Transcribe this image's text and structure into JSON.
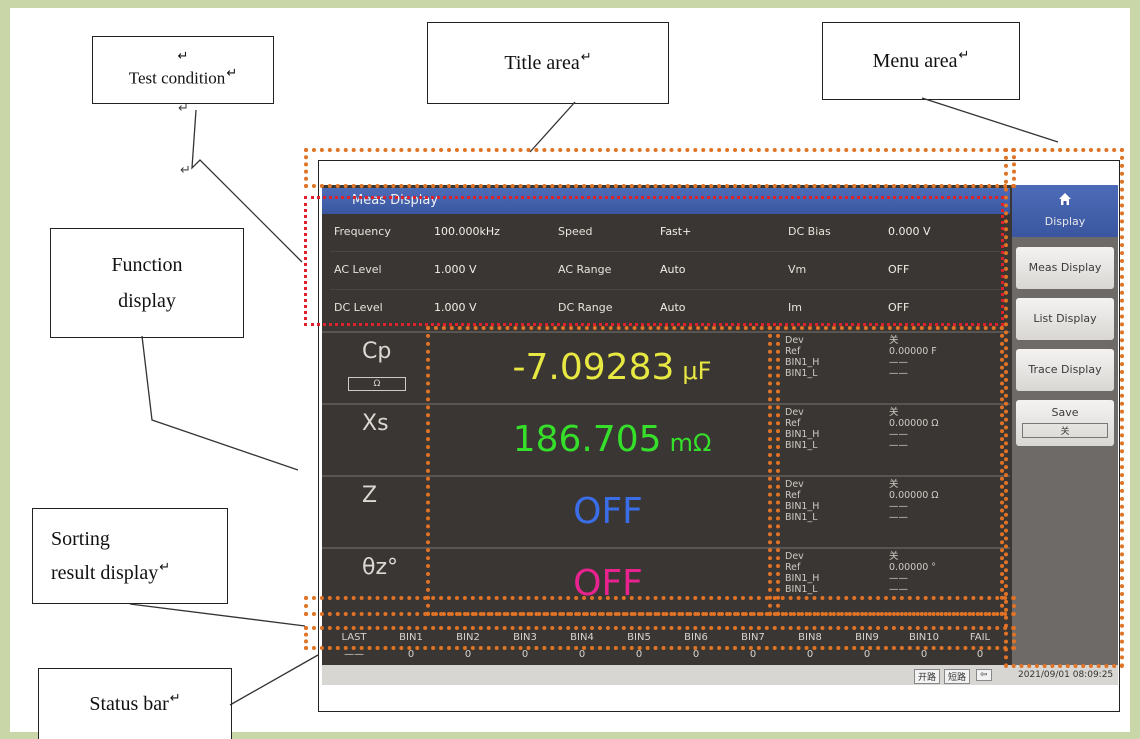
{
  "callouts": {
    "test_condition": "Test condition",
    "title_area": "Title area",
    "menu_area": "Menu area",
    "function_display_line1": "Function",
    "function_display_line2": "display",
    "sorting_line1": "Sorting",
    "sorting_line2": "result display",
    "status_bar": "Status bar",
    "return_mark": "↵"
  },
  "screen": {
    "title": "Meas Display",
    "conditions": [
      {
        "label1": "Frequency",
        "value1": "100.000kHz",
        "label2": "Speed",
        "value2": "Fast+",
        "label3": "DC Bias",
        "value3": "0.000 V"
      },
      {
        "label1": "AC Level",
        "value1": "1.000 V",
        "label2": "AC Range",
        "value2": "Auto",
        "label3": "Vm",
        "value3": "OFF"
      },
      {
        "label1": "DC Level",
        "value1": "1.000 V",
        "label2": "DC Range",
        "value2": "Auto",
        "label3": "Im",
        "value3": "OFF"
      }
    ],
    "measurements": [
      {
        "param": "Cp",
        "value": "-7.09283",
        "unit": "μF",
        "color": "#e8e842",
        "dev": "关",
        "ref": "0.00000 F"
      },
      {
        "param": "Xs",
        "value": "186.705",
        "unit": "mΩ",
        "color": "#36e02a",
        "dev": "关",
        "ref": "0.00000 Ω"
      },
      {
        "param": "Z",
        "value": "OFF",
        "unit": "",
        "color": "#3a6ee8",
        "dev": "关",
        "ref": "0.00000 Ω"
      },
      {
        "param": "θz°",
        "value": "OFF",
        "unit": "",
        "color": "#e8238f",
        "dev": "关",
        "ref": "0.00000 °"
      }
    ],
    "side_labels": {
      "dev": "Dev",
      "ref": "Ref",
      "bin_h": "BIN1_H",
      "bin_l": "BIN1_L",
      "blank": "——"
    },
    "param_selector": "Ω",
    "bins": [
      "LAST",
      "BIN1",
      "BIN2",
      "BIN3",
      "BIN4",
      "BIN5",
      "BIN6",
      "BIN7",
      "BIN8",
      "BIN9",
      "BIN10",
      "FAIL"
    ],
    "bin_values": [
      "——",
      "0",
      "0",
      "0",
      "0",
      "0",
      "0",
      "0",
      "0",
      "0",
      "0",
      "0"
    ],
    "status": {
      "btn1": "开路",
      "btn2": "短路",
      "btn3": "⇦",
      "datetime": "2021/09/01 08:09:25"
    }
  },
  "menu": {
    "home_icon": "home-icon",
    "section": "Display",
    "items": [
      "Meas Display",
      "List Display",
      "Trace Display"
    ],
    "save_label": "Save",
    "save_value": "关"
  }
}
